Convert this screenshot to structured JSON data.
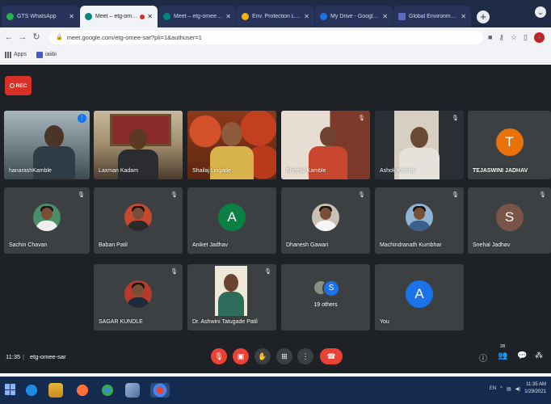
{
  "browser": {
    "tabs": [
      {
        "label": "GTS WhatsApp",
        "fav": "#2bb24c",
        "active": false
      },
      {
        "label": "Meet – etg-omee",
        "fav": "#00897b",
        "active": true,
        "recording": true
      },
      {
        "label": "Meet – etg-omee-sar",
        "fav": "#00897b",
        "active": false
      },
      {
        "label": "Env. Protection Law -",
        "fav": "#f4b400",
        "active": false
      },
      {
        "label": "My Drive - Google Dr",
        "fav": "#1a73e8",
        "active": false
      },
      {
        "label": "Global Environmental",
        "fav": "#5c6bc0",
        "active": false
      }
    ],
    "url": "meet.google.com/etg-omee-sar?pli=1&authuser=1",
    "bookmarks": [
      {
        "label": "Apps"
      },
      {
        "label": "iaiibi"
      }
    ]
  },
  "meet": {
    "rec_label": "REC",
    "meeting_time": "11:35",
    "separator": "|",
    "meeting_code": "etg-omee-sar",
    "tiles": [
      {
        "name": "hanarashKamble"
      },
      {
        "name": "Laxman Kadam"
      },
      {
        "name": "Shailaj Lingade"
      },
      {
        "name": "Sheetal Kamble"
      },
      {
        "name": "Ashok Kolekar"
      },
      {
        "name": "TEJASWINI JADHAV",
        "initial": "T",
        "color": "#e8710a"
      },
      {
        "name": "Sachin Chavan"
      },
      {
        "name": "Baban Patil"
      },
      {
        "name": "Aniket Jadhav",
        "initial": "A",
        "color": "#0b8043"
      },
      {
        "name": "Dhanesh Gawari"
      },
      {
        "name": "Machindranath Kumbhar"
      },
      {
        "name": "Snehal Jadhav",
        "initial": "S",
        "color": "#795548"
      },
      {
        "name": "SAGAR KUNDLE"
      },
      {
        "name": "Dr. Ashwini Tatugade Patil"
      },
      {
        "name": "19 others",
        "initial": "S"
      },
      {
        "name": "You",
        "initial": "A",
        "color": "#1a73e8"
      }
    ],
    "controls": {
      "people_count": "28"
    }
  },
  "taskbar": {
    "lang": "EN",
    "time": "11:35 AM",
    "date": "1/29/2021"
  }
}
